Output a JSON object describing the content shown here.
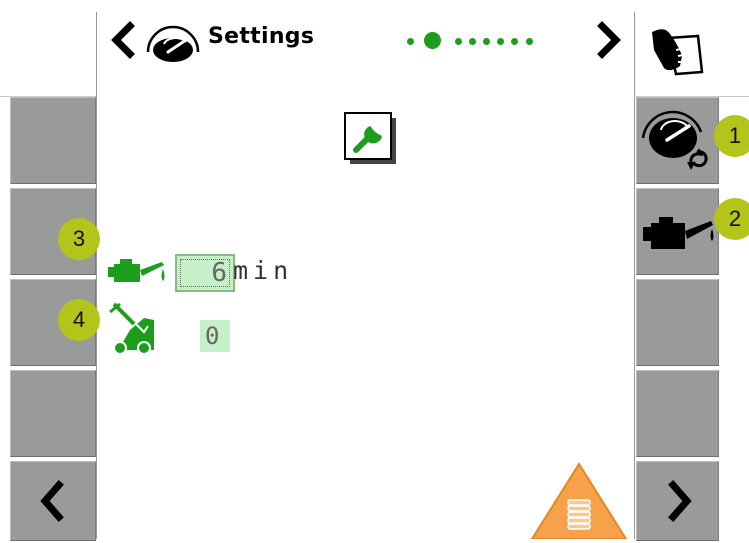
{
  "header": {
    "title": "Settings",
    "page_indicator": {
      "total": 8,
      "active": 1
    }
  },
  "fields": {
    "oil_interval": {
      "value": "6",
      "unit": "min"
    },
    "rotary_value": {
      "value": "0"
    }
  },
  "callouts": [
    "1",
    "2",
    "3",
    "4"
  ],
  "icons": {
    "header_gauge": "gauge-icon",
    "main": "wrench-icon",
    "hand": "hand-icon",
    "right_btn_1": "gauge-refresh-icon",
    "right_btn_2": "oil-can-icon",
    "field_1": "oil-can-icon",
    "field_2": "rotary-rake-icon",
    "warning": "warning-stack-icon"
  },
  "colors": {
    "accent_green": "#1c9e1c",
    "field_bg": "#c8f0c8",
    "button_gray": "#9a9a9a",
    "callout": "#b3c51b",
    "warning": "#f7a24a"
  }
}
